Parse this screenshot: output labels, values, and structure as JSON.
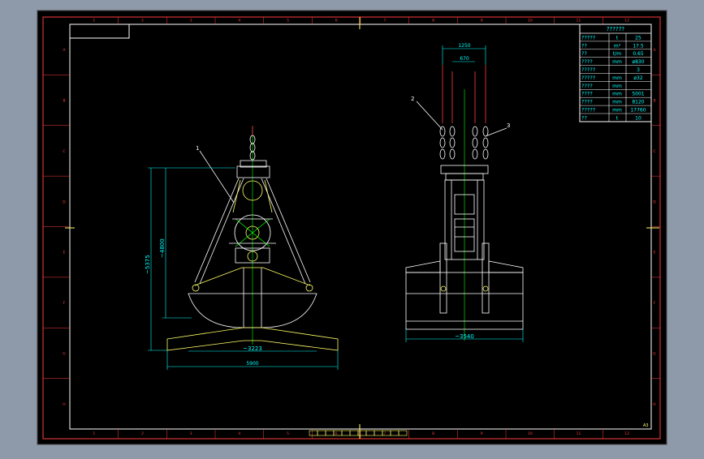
{
  "drawing": {
    "background_color": "#000000",
    "frame_color": "#ff3b3b",
    "line_color": "#ffffff",
    "dim_color": "#00ffff",
    "accent_color": "#ffff66",
    "center_color": "#00ff00"
  },
  "table": {
    "title": "??????",
    "rows": [
      {
        "label": "?????",
        "unit": "t",
        "value": "25"
      },
      {
        "label": "??",
        "unit": "m³",
        "value": "17.5"
      },
      {
        "label": "??",
        "unit": "t/m",
        "value": "0.65"
      },
      {
        "label": "????",
        "unit": "mm",
        "value": "ø830"
      },
      {
        "label": "?????",
        "unit": "",
        "value": "3"
      },
      {
        "label": "?????",
        "unit": "mm",
        "value": "ø32"
      },
      {
        "label": "????",
        "unit": "mm",
        "value": ""
      },
      {
        "label": "????",
        "unit": "mm",
        "value": "5001"
      },
      {
        "label": "????",
        "unit": "mm",
        "value": "8120"
      },
      {
        "label": "?????",
        "unit": "mm",
        "value": "17760"
      },
      {
        "label": "??",
        "unit": "t",
        "value": "10"
      }
    ]
  },
  "left_view": {
    "dim_height_outer": "~5375",
    "dim_height_inner": "~4800",
    "dim_width_closed": "~3223",
    "dim_width_open": "5900",
    "callout": "1"
  },
  "right_view": {
    "dim_top_outer": "1250",
    "dim_top_inner": "670",
    "dim_width": "~3540",
    "callout_left": "2",
    "callout_right": "3"
  },
  "border": {
    "columns": [
      "1",
      "2",
      "3",
      "4",
      "5",
      "6",
      "7",
      "8",
      "9",
      "10",
      "11",
      "12"
    ],
    "rows": [
      "A",
      "B",
      "C",
      "D",
      "E",
      "F",
      "G",
      "H"
    ],
    "sheet_label": "A3"
  }
}
